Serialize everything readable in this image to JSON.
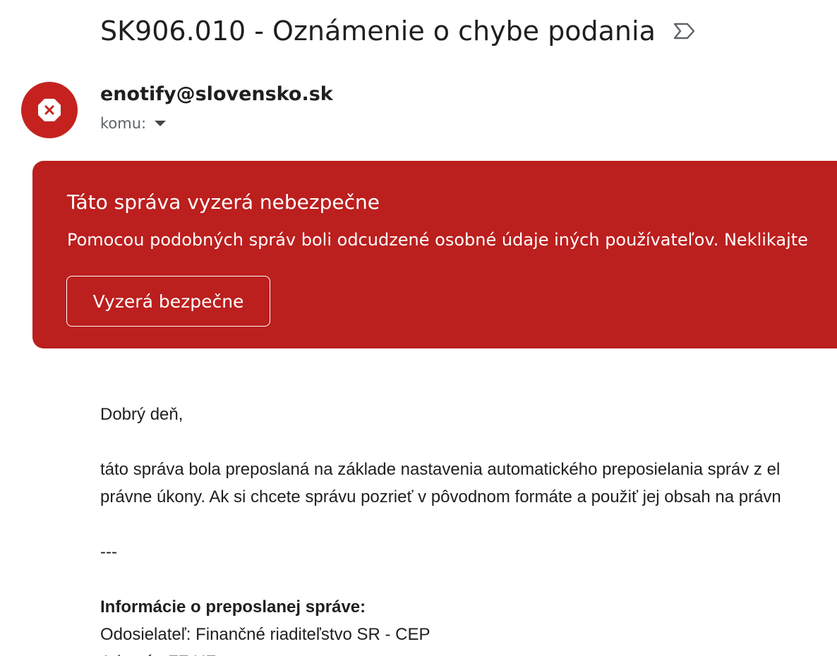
{
  "email": {
    "subject": "SK906.010 - Oznámenie o chybe podania",
    "sender": "enotify@slovensko.sk",
    "to_label": "komu:",
    "importance_icon": "importance-marker-icon",
    "avatar_icon": "stop-x-icon",
    "avatar_color": "#c5221f"
  },
  "warning": {
    "title": "Táto správa vyzerá nebezpečne",
    "text": "Pomocou podobných správ boli odcudzené osobné údaje iných používateľov. Neklikajte",
    "button_label": "Vyzerá bezpečne",
    "background": "#bb1f1e"
  },
  "body": {
    "greeting": "Dobrý deň,",
    "line1": "táto správa bola preposlaná na základe nastavenia automatického preposielania správ z el",
    "line2": "právne úkony. Ak si chcete správu pozrieť v pôvodnom formáte a použiť jej obsah na právn",
    "separator": "---",
    "info_heading": "Informácie o preposlanej správe:",
    "sender_line": "Odosielateľ: Finančné riaditeľstvo SR - CEP",
    "partial_line": "Adresát: FZ UF"
  }
}
